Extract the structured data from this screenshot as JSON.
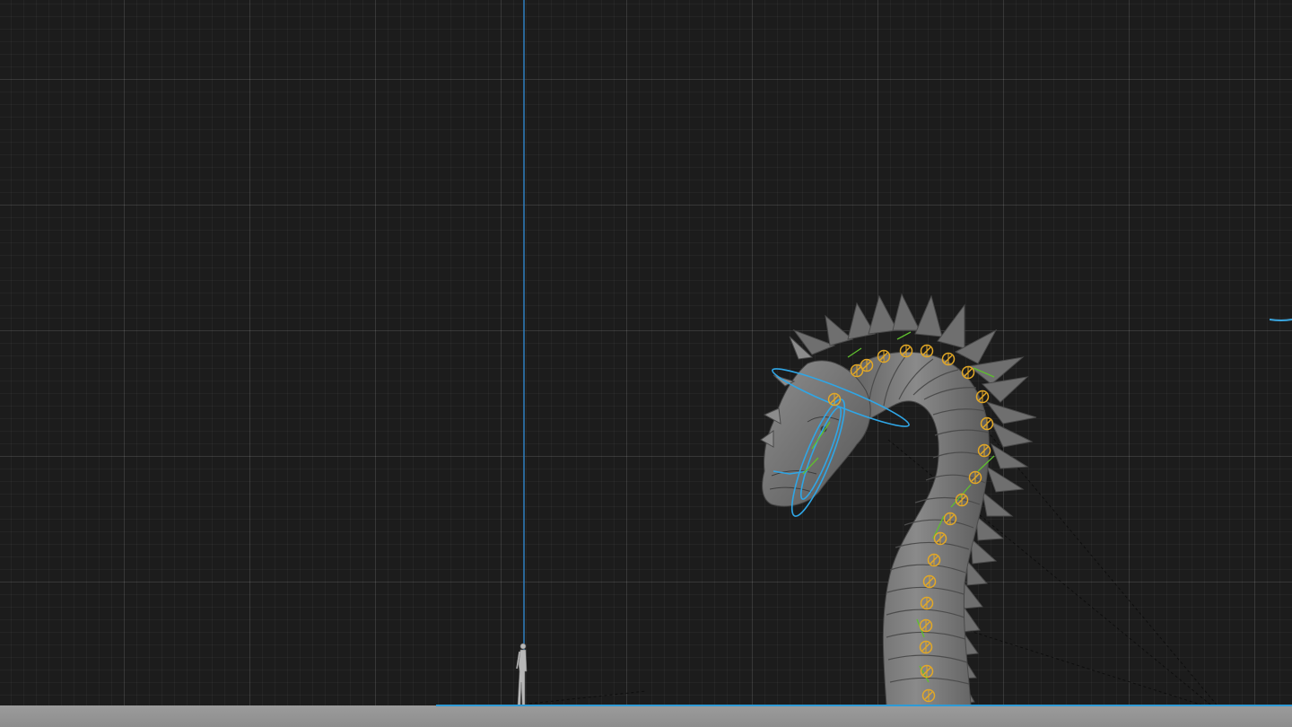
{
  "colors": {
    "background": "#1c1c1c",
    "grid_minor": "#262626",
    "grid_major": "#333333",
    "selection_blue": "#2f9bd6",
    "bone_yellow": "#e3a826",
    "bone_green": "#5fbf2e",
    "mesh_gray": "#7a7a7a",
    "ground": "#9b9b9b"
  },
  "scene": {
    "objects": [
      {
        "kind": "dragon-mesh",
        "icon": "dragon-icon"
      },
      {
        "kind": "human-reference-figure",
        "icon": "person-icon"
      },
      {
        "kind": "ground-plane"
      },
      {
        "kind": "vertical-axis-line"
      },
      {
        "kind": "armature-bones"
      },
      {
        "kind": "ik-control-rings"
      }
    ]
  }
}
